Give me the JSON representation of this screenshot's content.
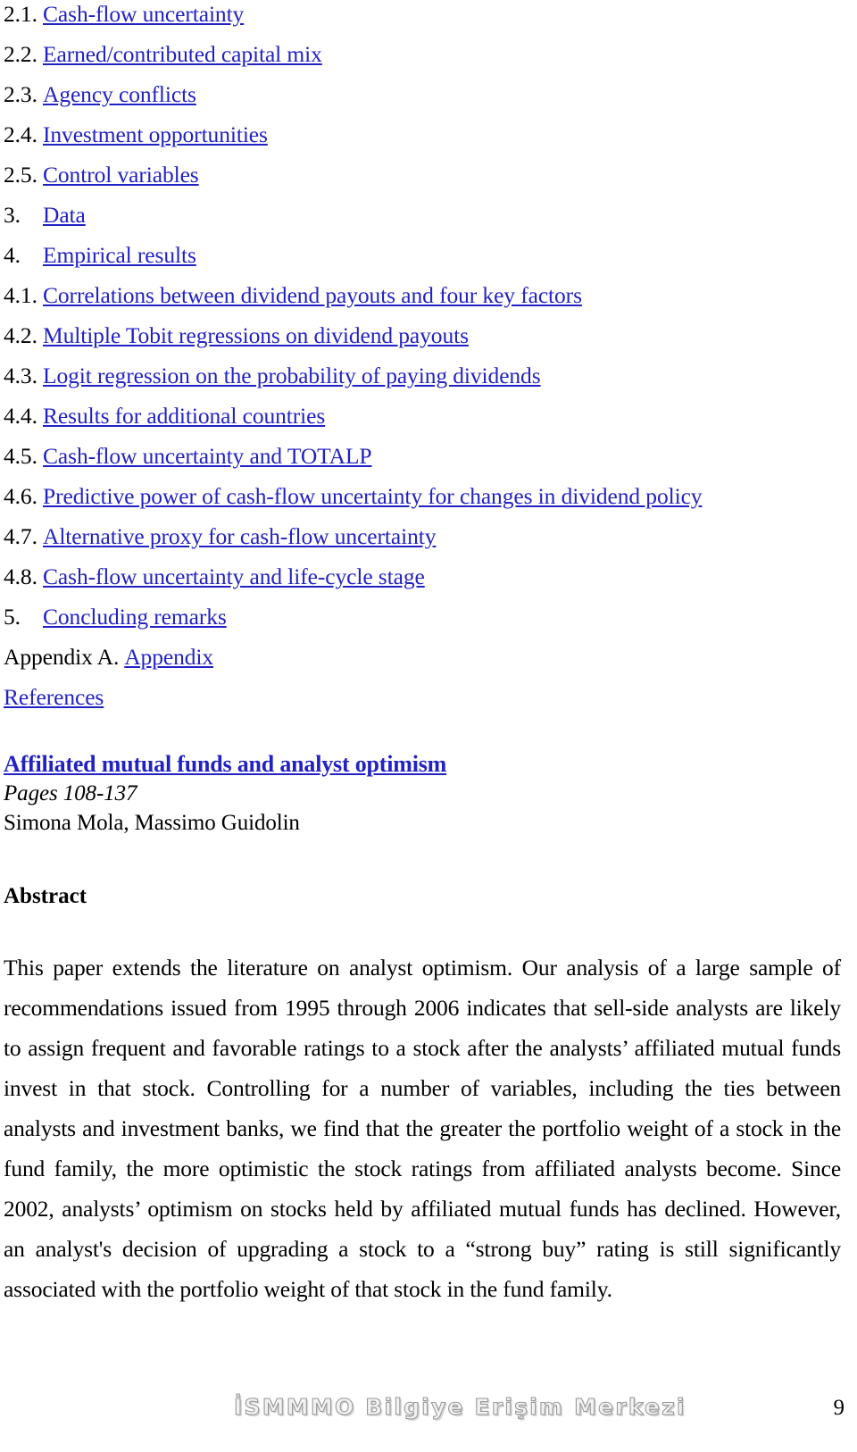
{
  "toc": {
    "items": [
      {
        "number": "2.1.",
        "label": "Cash-flow uncertainty",
        "linked": true
      },
      {
        "number": "2.2.",
        "label": "Earned/contributed capital mix",
        "linked": true
      },
      {
        "number": "2.3.",
        "label": "Agency conflicts",
        "linked": true
      },
      {
        "number": "2.4.",
        "label": "Investment opportunities",
        "linked": true
      },
      {
        "number": "2.5.",
        "label": "Control variables",
        "linked": true
      },
      {
        "number": "3.",
        "label": "Data",
        "linked": true
      },
      {
        "number": "4.",
        "label": "Empirical results",
        "linked": true
      },
      {
        "number": "4.1.",
        "label": "Correlations between dividend payouts and four key factors",
        "linked": true
      },
      {
        "number": "4.2.",
        "label": "Multiple Tobit regressions on dividend payouts",
        "linked": true
      },
      {
        "number": "4.3.",
        "label": "Logit regression on the probability of paying dividends",
        "linked": true
      },
      {
        "number": "4.4.",
        "label": "Results for additional countries",
        "linked": true
      },
      {
        "number": "4.5.",
        "label": "Cash-flow uncertainty and TOTALP",
        "linked": true
      },
      {
        "number": "4.6.",
        "label": "Predictive power of cash-flow uncertainty for changes in dividend policy",
        "linked": true
      },
      {
        "number": "4.7.",
        "label": "Alternative proxy for cash-flow uncertainty",
        "linked": true
      },
      {
        "number": "4.8.",
        "label": "Cash-flow uncertainty and life-cycle stage",
        "linked": true
      },
      {
        "number": "5.",
        "label": "Concluding remarks",
        "linked": true
      },
      {
        "number": "Appendix A.",
        "label": "Appendix",
        "linked": true
      },
      {
        "number": "",
        "label": "References",
        "linked": true
      }
    ]
  },
  "article": {
    "title": "Affiliated mutual funds and analyst optimism",
    "pages": "Pages 108-137",
    "authors": "Simona Mola, Massimo Guidolin",
    "abstract_heading": "Abstract",
    "abstract": "This paper extends the literature on analyst optimism. Our analysis of a large sample of recommendations issued from 1995 through 2006 indicates that sell-side analysts are likely to assign frequent and favorable ratings to a stock after the analysts’ affiliated mutual funds invest in that stock. Controlling for a number of variables, including the ties between analysts and investment banks, we find that the greater the portfolio weight of a stock in the fund family, the more optimistic the stock ratings from affiliated analysts become. Since 2002, analysts’ optimism on stocks held by affiliated mutual funds has declined. However, an analyst's decision of upgrading a stock to a “strong buy” rating is still significantly associated with the portfolio weight of that stock in the fund family."
  },
  "footer": {
    "watermark": "İSMMMO Bilgiye Erişim Merkezi",
    "page_number": "9"
  },
  "colors": {
    "link": "#2222c4",
    "text": "#000000",
    "watermark": "#c9c9c9"
  }
}
